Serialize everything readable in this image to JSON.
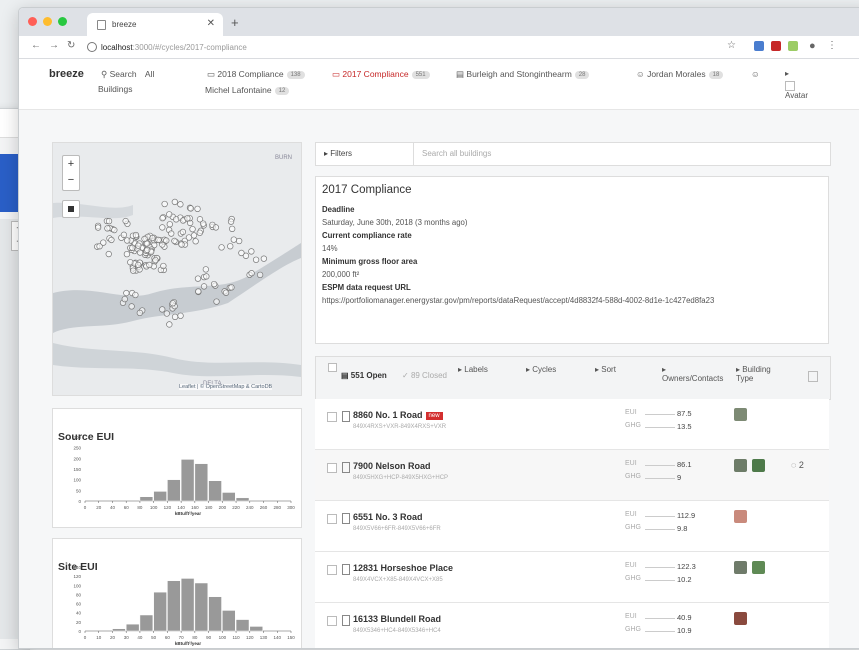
{
  "browser": {
    "tab_title": "breeze",
    "url_host": "localhost",
    "url_path": ":3000/#/cycles/2017-compliance"
  },
  "header": {
    "brand": "breeze",
    "search": "Search",
    "all_buildings_1": "All",
    "all_buildings_2": "Buildings",
    "bookmarks": [
      {
        "label": "2018 Compliance",
        "count": "138"
      },
      {
        "label": "2017 Compliance",
        "count": "551"
      },
      {
        "label": "Burleigh and Stonginthearm",
        "count": "28"
      },
      {
        "label": "Jordan Morales",
        "count": "18"
      }
    ],
    "michel": {
      "label": "Michel Lafontaine",
      "count": "12"
    },
    "avatar": "Avatar"
  },
  "map": {
    "label_top": "BURN",
    "label_delta": "DELTA",
    "attribution": "Leaflet | © OpenStreetMap & CartoDB"
  },
  "filters": {
    "button": "Filters",
    "placeholder": "Search all buildings"
  },
  "cycle": {
    "title": "2017 Compliance",
    "deadline_label": "Deadline",
    "deadline_value": "Saturday, June 30th, 2018 (3 months ago)",
    "rate_label": "Current compliance rate",
    "rate_value": "14%",
    "area_label": "Minimum gross floor area",
    "area_value": "200,000 ft²",
    "espm_label": "ESPM data request URL",
    "espm_value": "https://portfoliomanager.energystar.gov/pm/reports/dataRequest/accept/4d8832f4-588d-4002-8d1e-1c427ed8fa23"
  },
  "list": {
    "open": "551 Open",
    "closed": "89 Closed",
    "labels": "Labels",
    "cycles": "Cycles",
    "sort": "Sort",
    "owners": "Owners/Contacts",
    "building": "Building",
    "type": "Type"
  },
  "rows": [
    {
      "name": "8860 No. 1 Road",
      "code": "849X4RXS+VXR-849X4RXS+VXR",
      "eui": "87.5",
      "ghg": "13.5",
      "is_new": "new"
    },
    {
      "name": "7900 Nelson Road",
      "code": "849X5HXG+HCP-849X5HXG+HCP",
      "eui": "86.1",
      "ghg": "9",
      "comments": "2"
    },
    {
      "name": "6551 No. 3 Road",
      "code": "849X5V66+6FR-849X5V66+6FR",
      "eui": "112.9",
      "ghg": "9.8"
    },
    {
      "name": "12831 Horseshoe Place",
      "code": "849X4VCX+X85-849X4VCX+X85",
      "eui": "122.3",
      "ghg": "10.2"
    },
    {
      "name": "16133 Blundell Road",
      "code": "849X5346+HC4-849X5346+HC4",
      "eui": "40.9",
      "ghg": "10.9"
    }
  ],
  "eui_labels": {
    "k1": "EUI",
    "k2": "GHG"
  },
  "chart_data": [
    {
      "type": "bar",
      "title": "Source EUI",
      "xlabel": "kBtu/ft²/year",
      "categories": [
        "0",
        "20",
        "40",
        "60",
        "80",
        "100",
        "120",
        "140",
        "160",
        "180",
        "200",
        "220",
        "240",
        "260",
        "280"
      ],
      "x_ticks": [
        "0",
        "20",
        "40",
        "60",
        "80",
        "100",
        "120",
        "140",
        "160",
        "180",
        "200",
        "220",
        "240",
        "260",
        "280",
        "300"
      ],
      "values": [
        0,
        0,
        0,
        0,
        20,
        45,
        100,
        195,
        175,
        95,
        40,
        15,
        0,
        0,
        0
      ],
      "y_ticks": [
        "0",
        "50",
        "100",
        "150",
        "200",
        "250",
        "300"
      ],
      "ylim": [
        0,
        300
      ]
    },
    {
      "type": "bar",
      "title": "Site EUI",
      "xlabel": "kBtu/ft²/year",
      "categories": [
        "0",
        "10",
        "20",
        "30",
        "40",
        "50",
        "60",
        "70",
        "80",
        "90",
        "100",
        "110",
        "120",
        "130",
        "140"
      ],
      "x_ticks": [
        "0",
        "10",
        "20",
        "30",
        "40",
        "50",
        "60",
        "70",
        "80",
        "90",
        "100",
        "110",
        "120",
        "130",
        "140",
        "150"
      ],
      "values": [
        0,
        0,
        5,
        15,
        35,
        85,
        110,
        115,
        105,
        75,
        45,
        25,
        10,
        0,
        0
      ],
      "y_ticks": [
        "0",
        "20",
        "40",
        "60",
        "80",
        "100",
        "120",
        "140"
      ],
      "ylim": [
        0,
        140
      ]
    }
  ],
  "colors": {
    "accent": "#c62828",
    "blue": "#2a5fc7"
  }
}
